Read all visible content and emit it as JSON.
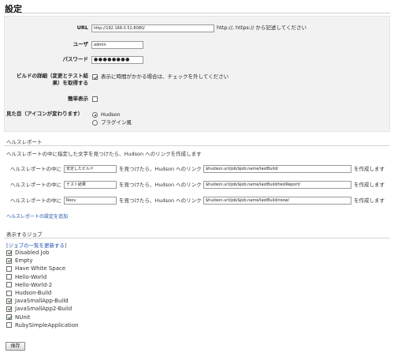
{
  "page": {
    "title": "設定"
  },
  "form": {
    "url": {
      "label": "URL",
      "value": "http://192.168.0.51:8080/",
      "hint": "http://, https:// から記述してください"
    },
    "user": {
      "label": "ユーザ",
      "value": "admin"
    },
    "password": {
      "label": "パスワード",
      "value": "●●●●●●●●"
    },
    "build_detail": {
      "label_line1": "ビルドの詳細（変更とテスト結",
      "label_line2": "果）を取得する",
      "checked": true,
      "hint": "表示に時間がかかる場合は、チェックを外してください"
    },
    "simple_view": {
      "label": "簡単表示",
      "checked": false
    },
    "appearance": {
      "label": "見た目（アイコンが変わります）",
      "options": [
        {
          "label": "Hudson",
          "selected": true
        },
        {
          "label": "プラグイン風",
          "selected": false
        }
      ]
    }
  },
  "health": {
    "section_title": "ヘルスレポート",
    "intro": "ヘルスレポートの中に指定した文字を見つけたら、Hudson へのリンクを作成します",
    "prefix": "ヘルスレポートの中に",
    "middle": "を見つけたら、Hudson へのリンク",
    "suffix": "を作成します",
    "rows": [
      {
        "keyword": "安定したビルド",
        "link": "$hudson.url/job/$job.name/lastBuild/"
      },
      {
        "keyword": "テスト結果",
        "link": "$hudson.url/job/$job.name/lastBuild/testReport/"
      },
      {
        "keyword": "Roov",
        "link": "$hudson.url/job/$job.name/lastBuild/roow/"
      }
    ],
    "add_link": "ヘルスレポートの設定を追加"
  },
  "jobs": {
    "section_title": "表示するジョブ",
    "refresh_link": "[ジョブの一覧を更新する]",
    "items": [
      {
        "name": "Disabled Job",
        "checked": true
      },
      {
        "name": "Empty",
        "checked": true
      },
      {
        "name": "Have White Space",
        "checked": false
      },
      {
        "name": "Hello-World",
        "checked": false
      },
      {
        "name": "Hello-World-2",
        "checked": false
      },
      {
        "name": "Hudson-Build",
        "checked": false
      },
      {
        "name": "JavaSmallApp-Build",
        "checked": true
      },
      {
        "name": "JavaSmallApp2-Build",
        "checked": true
      },
      {
        "name": "NUnit",
        "checked": true
      },
      {
        "name": "RubySimpleApplication",
        "checked": false
      }
    ]
  },
  "footer": {
    "save_label": "保存"
  }
}
